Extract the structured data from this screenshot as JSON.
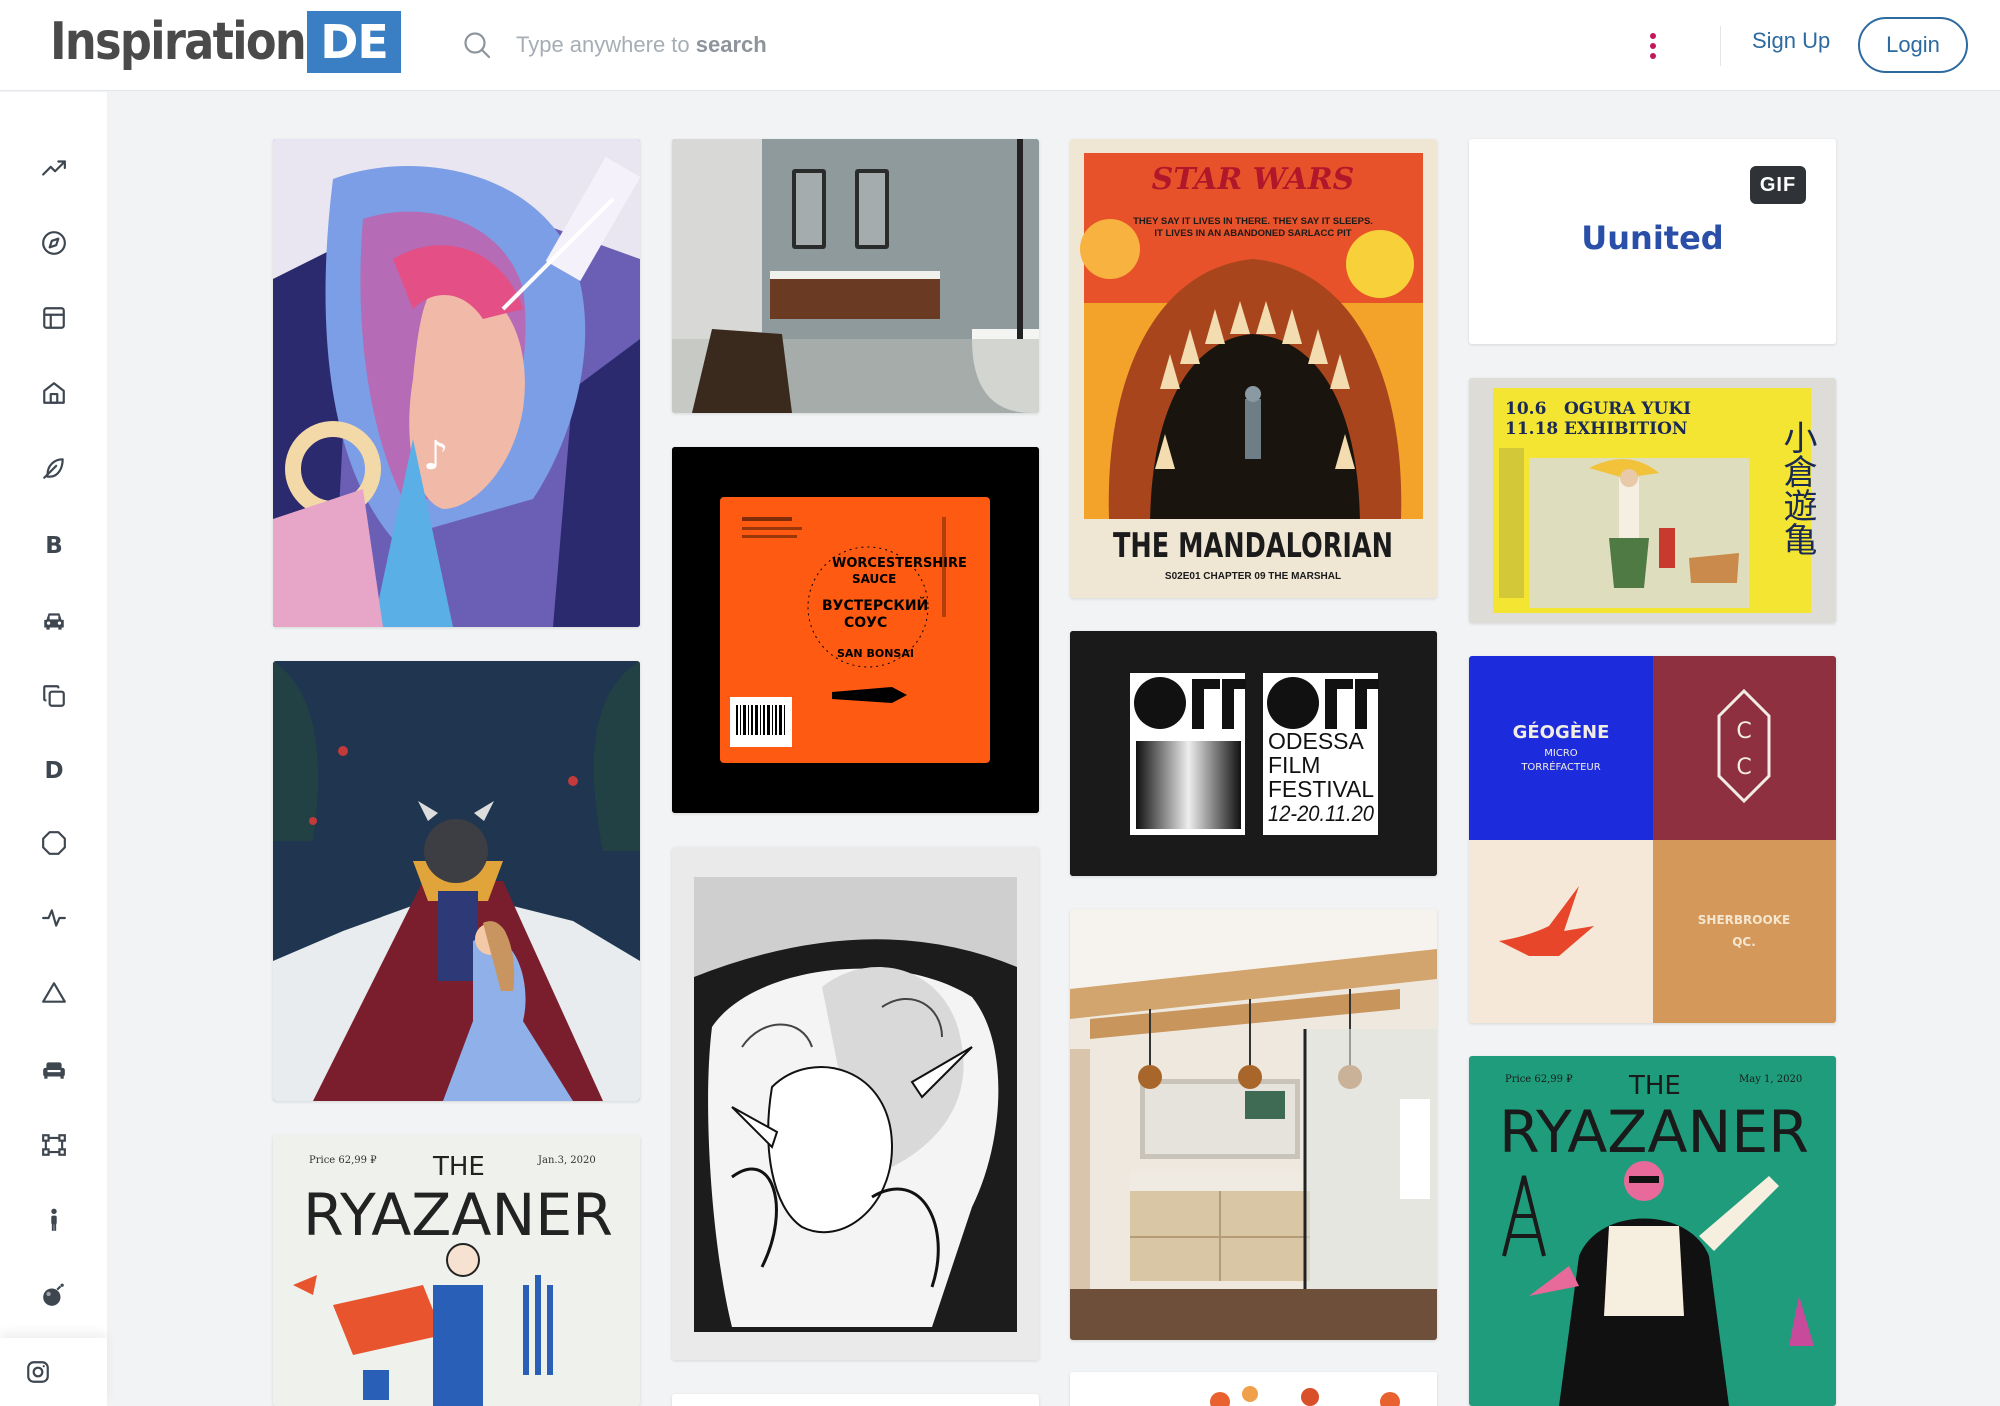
{
  "header": {
    "logo_word": "Inspiration",
    "logo_badge": "DE",
    "search_prefix": "Type anywhere to ",
    "search_strong": "search",
    "signup_label": "Sign Up",
    "login_label": "Login"
  },
  "sidebar": {
    "items": [
      {
        "icon": "trending-up-icon"
      },
      {
        "icon": "compass-icon"
      },
      {
        "icon": "layout-icon"
      },
      {
        "icon": "home-icon"
      },
      {
        "icon": "feather-icon"
      },
      {
        "icon": "letter-b-icon",
        "letter": "B"
      },
      {
        "icon": "car-icon"
      },
      {
        "icon": "copy-icon"
      },
      {
        "icon": "letter-d-icon",
        "letter": "D"
      },
      {
        "icon": "octagon-icon"
      },
      {
        "icon": "activity-icon"
      },
      {
        "icon": "triangle-icon"
      },
      {
        "icon": "sofa-icon"
      },
      {
        "icon": "vector-nodes-icon"
      },
      {
        "icon": "person-icon"
      },
      {
        "icon": "bomb-icon"
      }
    ],
    "bottom_icon": "instagram-icon"
  },
  "cards": {
    "bathroom_grey": {
      "description": "bathroom interior"
    },
    "starwars": {
      "title": "STAR WARS",
      "tagline_1": "THEY SAY IT LIVES IN THERE. THEY SAY IT SLEEPS.",
      "tagline_2": "IT LIVES IN AN ABANDONED SARLACC PIT",
      "show": "THE MANDALORIAN",
      "episode": "S02E01 CHAPTER 09 THE MARSHAL"
    },
    "united": {
      "badge": "GIF",
      "brand": "Uunited"
    },
    "ogura": {
      "dates_1": "10.6",
      "dates_2": "11.18",
      "title_1": "OGURA YUKI",
      "title_2": "EXHIBITION",
      "kanji": "小倉遊亀"
    },
    "sauce": {
      "arc_1": "WORCESTERSHIRE",
      "arc_2": "SAUCE",
      "ru_1": "ВУСТЕРСКИЙ",
      "ru_2": "СОУС",
      "brand": "SAN BONSAI"
    },
    "off": {
      "line_1": "ODESSA",
      "line_2": "FILM",
      "line_3": "FESTIVAL",
      "dates": "12-20.11.20"
    },
    "geogene": {
      "name": "GÉOGÈNE",
      "sub_1": "MICRO",
      "sub_2": "TORRÉFACTEUR",
      "place_1": "SHERBROOKE",
      "place_2": "QC."
    },
    "ryazaner_1": {
      "price": "Price 62,99 ₽",
      "the": "THE",
      "name": "RYAZANER",
      "date": "Jan.3, 2020"
    },
    "ryazaner_2": {
      "price": "Price 62,99 ₽",
      "the": "THE",
      "name": "RYAZANER",
      "date": "May 1, 2020"
    }
  },
  "colors": {
    "brand_blue": "#3a7fc4",
    "link_blue": "#2c6aa0",
    "more_dots": "#c2185b"
  }
}
